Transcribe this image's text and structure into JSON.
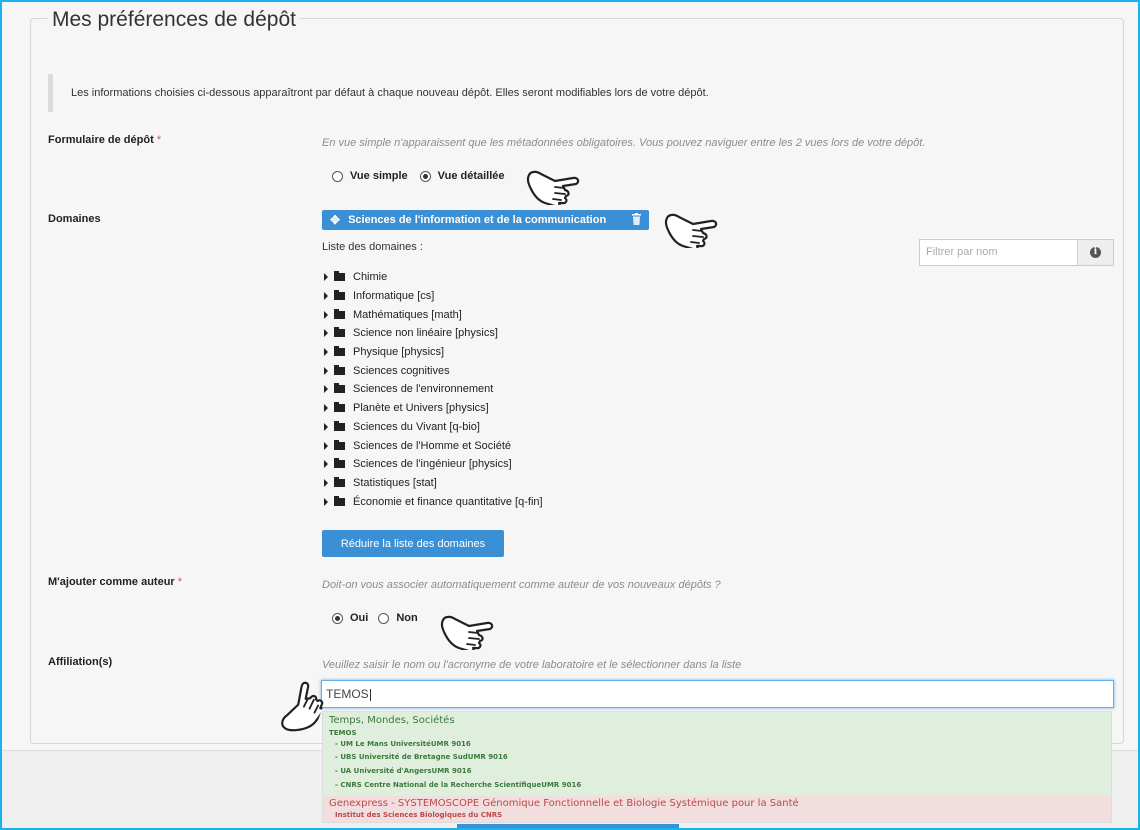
{
  "panel": {
    "title": "Mes préférences de dépôt",
    "info": "Les informations choisies ci-dessous apparaîtront par défaut à chaque nouveau dépôt. Elles seront modifiables lors de votre dépôt."
  },
  "required_mark": "*",
  "form_type": {
    "label": "Formulaire de dépôt",
    "help": "En vue simple n'apparaissent que les métadonnées obligatoires. Vous pouvez naviguer entre les 2 vues lors de votre dépôt.",
    "options": [
      "Vue simple",
      "Vue détaillée"
    ],
    "selected": "Vue détaillée"
  },
  "domains": {
    "label": "Domaines",
    "selected_tag": "Sciences de l'information et de la communication",
    "list_title": "Liste des domaines :",
    "filter_placeholder": "Filtrer par nom",
    "items": [
      "Chimie",
      "Informatique [cs]",
      "Mathématiques [math]",
      "Science non linéaire [physics]",
      "Physique [physics]",
      "Sciences cognitives",
      "Sciences de l'environnement",
      "Planète et Univers [physics]",
      "Sciences du Vivant [q-bio]",
      "Sciences de l'Homme et Société",
      "Sciences de l'ingénieur [physics]",
      "Statistiques [stat]",
      "Économie et finance quantitative [q-fin]"
    ],
    "reduce_button": "Réduire la liste des domaines"
  },
  "author": {
    "label": "M'ajouter comme auteur",
    "help": "Doit-on vous associer automatiquement comme auteur de vos nouveaux dépôts ?",
    "options": [
      "Oui",
      "Non"
    ],
    "selected": "Oui"
  },
  "affiliation": {
    "label": "Affiliation(s)",
    "help": "Veuillez saisir le nom ou l'acronyme de votre laboratoire et le sélectionner dans la liste",
    "value": "TEMOS",
    "suggestions": [
      {
        "name": "Temps, Mondes, Sociétés",
        "acronym": "TEMOS",
        "parents": [
          "- UM Le Mans UniversitéUMR 9016",
          "- UBS Université de Bretagne SudUMR 9016",
          "- UA Université d'AngersUMR 9016",
          "- CNRS Centre National de la Recherche ScientifiqueUMR 9016"
        ]
      },
      {
        "name": "Genexpress - SYSTEMOSCOPE Génomique Fonctionnelle et Biologie Systémique pour la Santé",
        "parent": "Institut des Sciences Biologiques du CNRS"
      }
    ]
  },
  "colors": {
    "accent": "#3b8fd4",
    "frame": "#1ab2ec",
    "match_bg": "#dfeedd",
    "nomatch_bg": "#f2dede"
  }
}
